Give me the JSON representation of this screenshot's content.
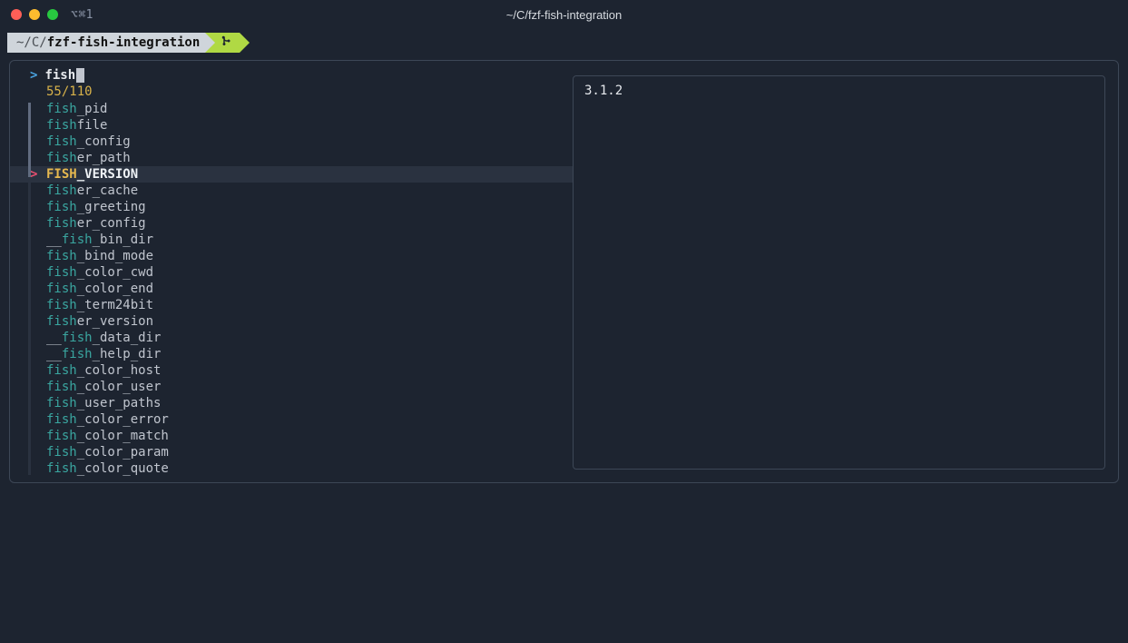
{
  "window": {
    "badge": "⌥⌘1",
    "title": "~/C/fzf-fish-integration"
  },
  "prompt": {
    "path_prefix": "~/C/",
    "cwd": "fzf-fish-integration",
    "branch_icon": "⎇"
  },
  "fzf": {
    "prompt_symbol": ">",
    "query": "fish",
    "count": "55/110",
    "selected_index": 4,
    "items": [
      {
        "m1": "fish",
        "r1": "_pid"
      },
      {
        "m1": "fish",
        "r1": "file"
      },
      {
        "m1": "fish",
        "r1": "_config"
      },
      {
        "m1": "fish",
        "r1": "er_path"
      },
      {
        "m1": "FISH",
        "r1": "_VERSION"
      },
      {
        "m1": "fish",
        "r1": "er_cache"
      },
      {
        "m1": "fish",
        "r1": "_greeting"
      },
      {
        "m1": "fish",
        "r1": "er_config"
      },
      {
        "p1": "__",
        "m1": "fish",
        "r1": "_bin_dir"
      },
      {
        "m1": "fish",
        "r1": "_bind_mode"
      },
      {
        "m1": "fish",
        "r1": "_color_cwd"
      },
      {
        "m1": "fish",
        "r1": "_color_end"
      },
      {
        "m1": "fish",
        "r1": "_term24bit"
      },
      {
        "m1": "fish",
        "r1": "er_version"
      },
      {
        "p1": "__",
        "m1": "fish",
        "r1": "_data_dir"
      },
      {
        "p1": "__",
        "m1": "fish",
        "r1": "_help_dir"
      },
      {
        "m1": "fish",
        "r1": "_color_host"
      },
      {
        "m1": "fish",
        "r1": "_color_user"
      },
      {
        "m1": "fish",
        "r1": "_user_paths"
      },
      {
        "m1": "fish",
        "r1": "_color_error"
      },
      {
        "m1": "fish",
        "r1": "_color_match"
      },
      {
        "m1": "fish",
        "r1": "_color_param"
      },
      {
        "m1": "fish",
        "r1": "_color_quote"
      }
    ]
  },
  "preview": {
    "value": "3.1.2"
  }
}
